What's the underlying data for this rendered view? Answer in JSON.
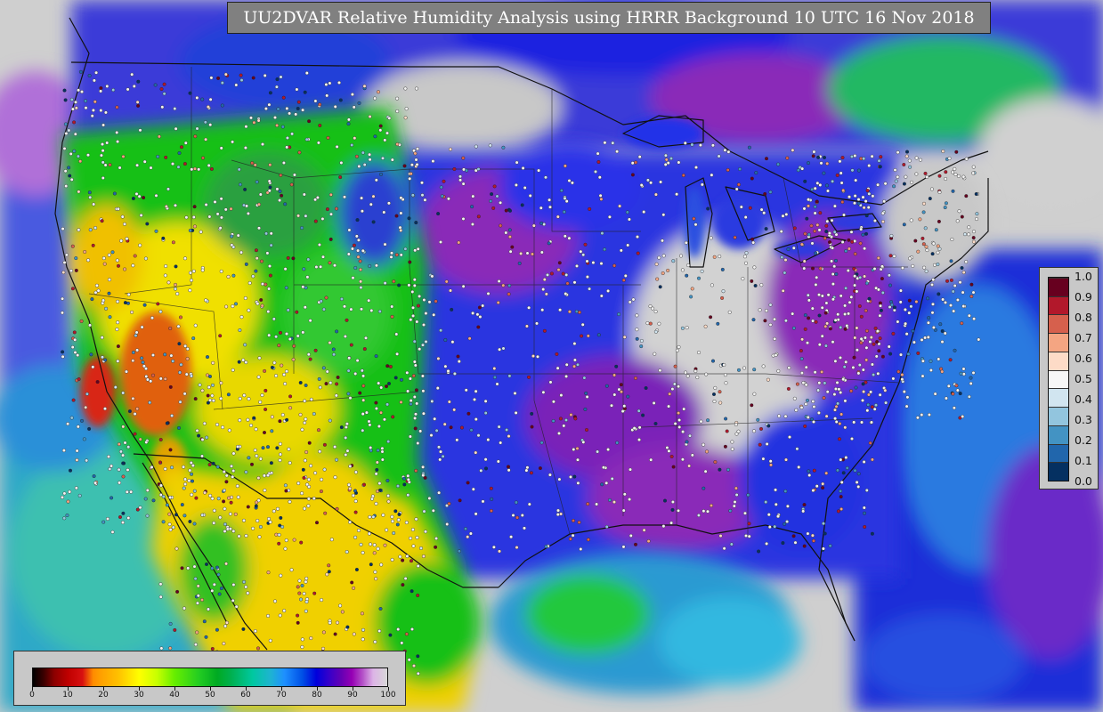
{
  "title": "UU2DVAR Relative Humidity Analysis using HRRR Background 10 UTC 16 Nov 2018",
  "rh_colorbar": {
    "tick_labels": [
      "0",
      "10",
      "20",
      "30",
      "40",
      "50",
      "60",
      "70",
      "80",
      "90",
      "100"
    ]
  },
  "ob_legend": {
    "labels": [
      "1.0",
      "0.9",
      "0.8",
      "0.7",
      "0.6",
      "0.5",
      "0.4",
      "0.3",
      "0.2",
      "0.1",
      "0.0"
    ],
    "colors": [
      "#67001f",
      "#b2182b",
      "#d6604d",
      "#f4a582",
      "#fddbc7",
      "#f7f7f7",
      "#d1e5f0",
      "#92c5de",
      "#4393c3",
      "#2166ac",
      "#053061"
    ]
  },
  "palette": {
    "ocean_pacific": "#2fa8c8",
    "ocean_atlantic": "#1a2fd8",
    "gulf": "#2a9ad2",
    "land_east": "#2a36e0",
    "land_east_purple": "#7a22b8",
    "land_west_yellow": "#f0e000",
    "land_west_green": "#18c018",
    "land_california": "#e06010",
    "clear_gray": "#d2d2d2",
    "gulf_green": "#22c83c"
  }
}
